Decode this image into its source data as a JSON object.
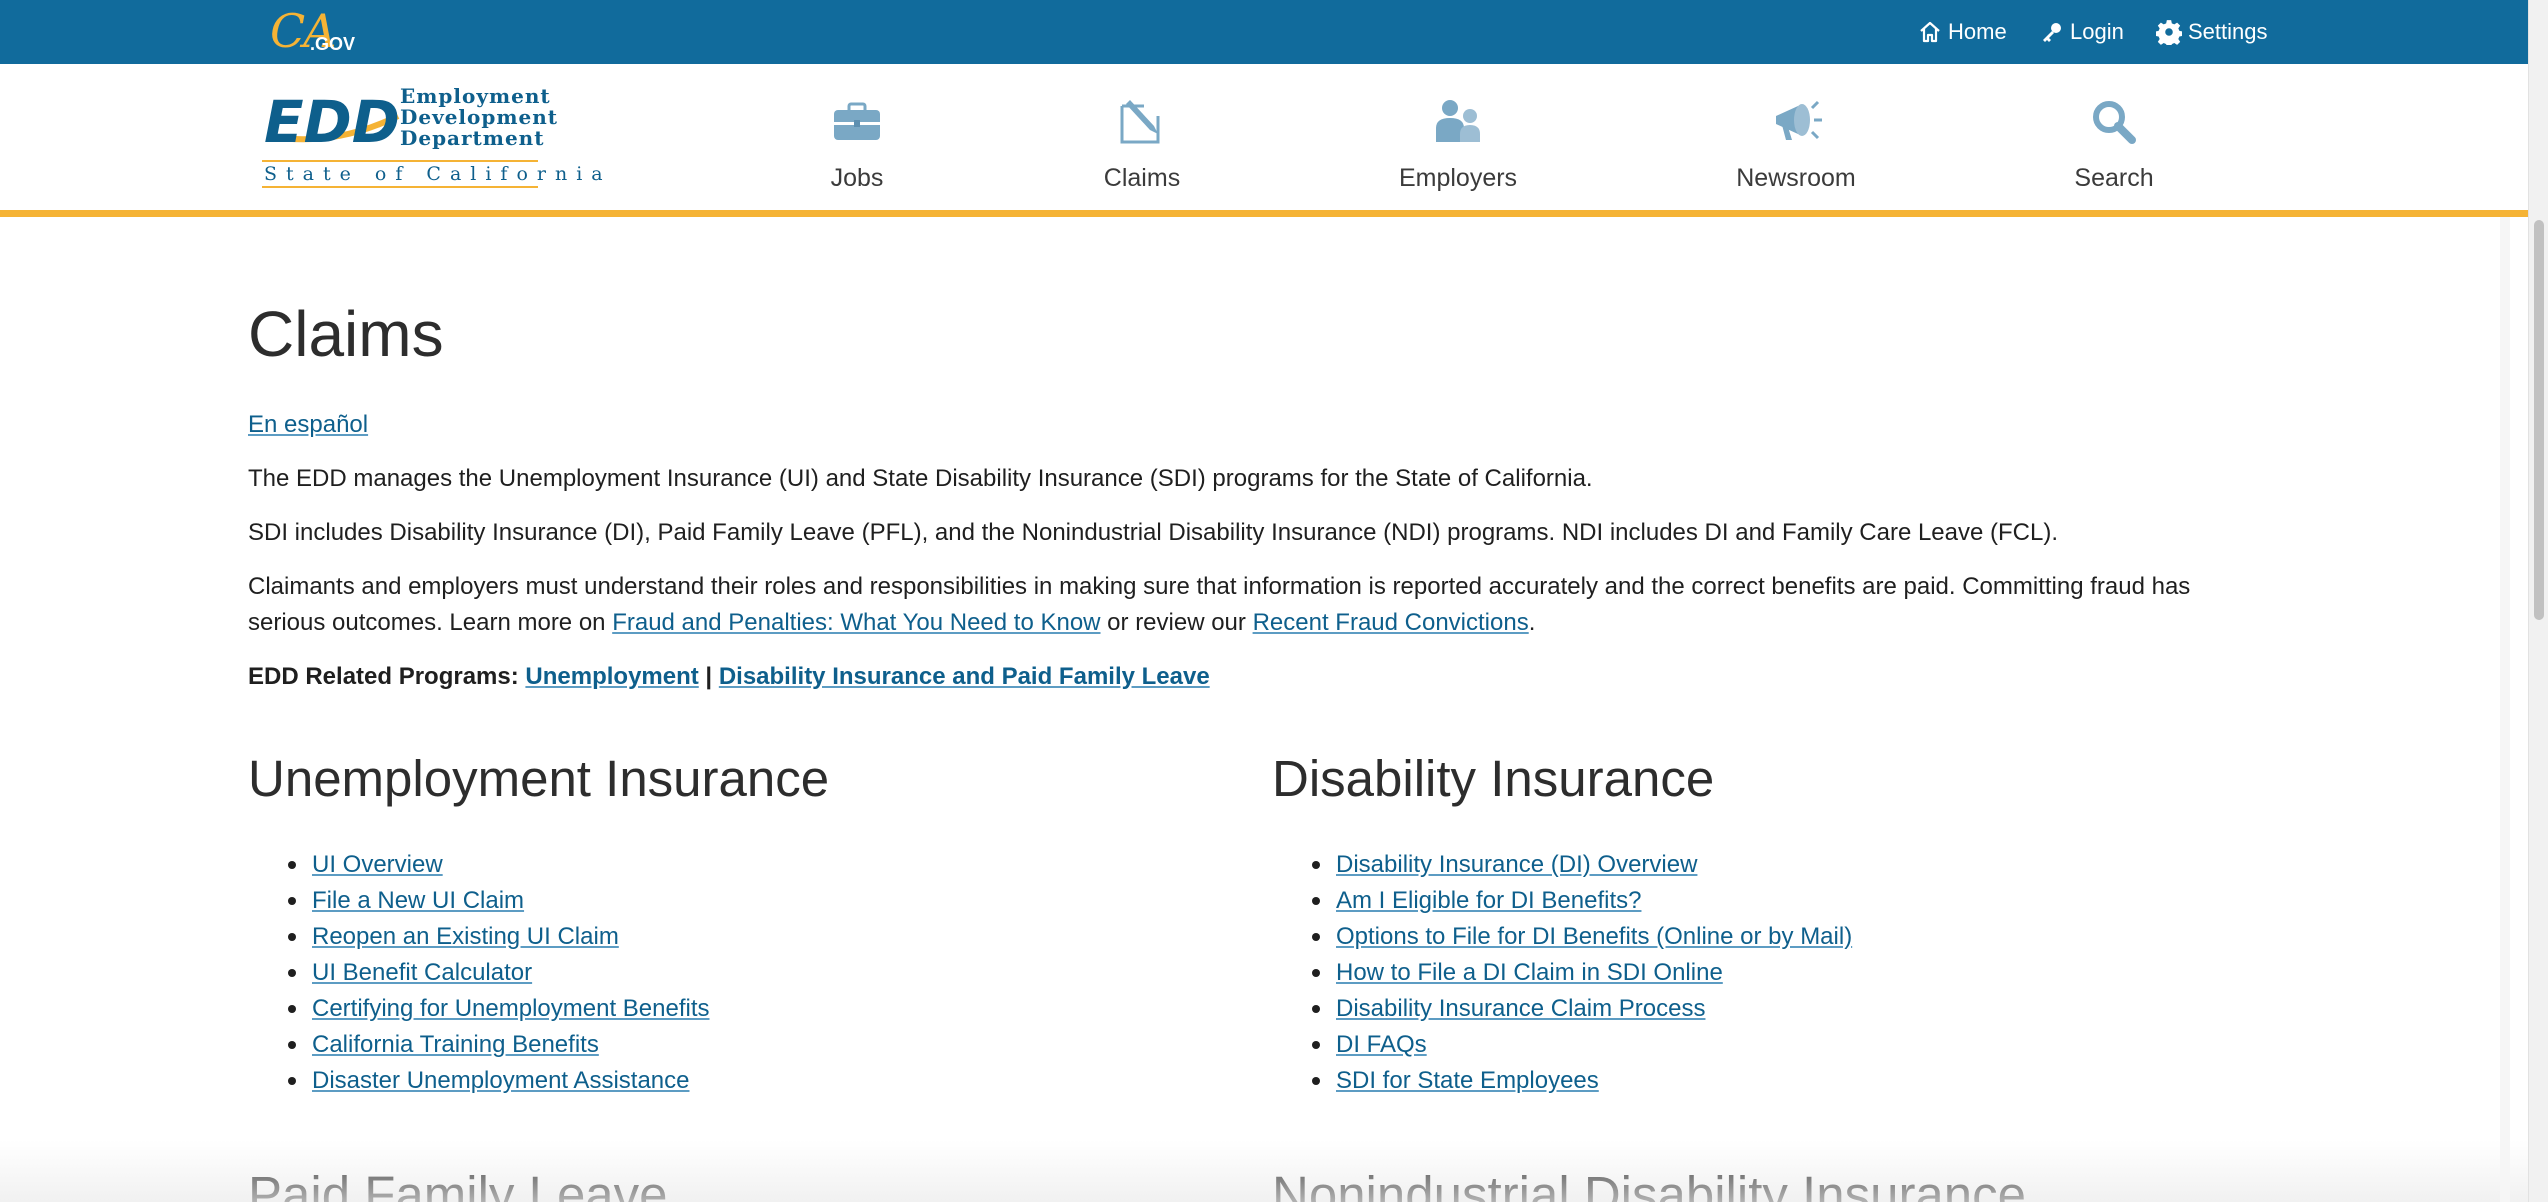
{
  "topbar": {
    "ca_logo_text": "CA",
    "ca_logo_gov": ".GOV",
    "home_label": "Home",
    "login_label": "Login",
    "settings_label": "Settings",
    "bg_color": "#116b9c"
  },
  "header": {
    "logo_line1": "Employment",
    "logo_line2": "Development",
    "logo_line3": "Department",
    "logo_state": "State of California",
    "logo_mark": "EDD",
    "nav": [
      {
        "label": "Jobs",
        "icon": "briefcase-icon"
      },
      {
        "label": "Claims",
        "icon": "claims-icon"
      },
      {
        "label": "Employers",
        "icon": "people-icon"
      },
      {
        "label": "Newsroom",
        "icon": "megaphone-icon"
      },
      {
        "label": "Search",
        "icon": "search-icon"
      }
    ],
    "accent_color": "#f5b335"
  },
  "main": {
    "title": "Claims",
    "espanol_link": "En español",
    "p1": "The EDD manages the Unemployment Insurance (UI) and State Disability Insurance (SDI) programs for the State of California.",
    "p2": "SDI includes Disability Insurance (DI), Paid Family Leave (PFL), and the Nonindustrial Disability Insurance (NDI) programs. NDI includes DI and Family Care Leave (FCL).",
    "p3_start": "Claimants and employers must understand their roles and responsibilities in making sure that information is reported accurately and the correct benefits are paid. Committing fraud has serious outcomes. Learn more on ",
    "p3_link1": "Fraud and Penalties: What You Need to Know",
    "p3_mid": " or review our ",
    "p3_link2": "Recent Fraud Convictions",
    "p3_end": ".",
    "related_label": "EDD Related Programs: ",
    "related_link1": "Unemployment",
    "related_sep": " | ",
    "related_link2": "Disability Insurance and Paid Family Leave",
    "sections": {
      "ui": {
        "title": "Unemployment Insurance",
        "links": [
          "UI Overview",
          "File a New UI Claim",
          "Reopen an Existing UI Claim",
          "UI Benefit Calculator",
          "Certifying for Unemployment Benefits",
          "California Training Benefits",
          "Disaster Unemployment Assistance"
        ]
      },
      "di": {
        "title": "Disability Insurance",
        "links": [
          "Disability Insurance (DI) Overview",
          "Am I Eligible for DI Benefits?",
          "Options to File for DI Benefits (Online or by Mail)",
          "How to File a DI Claim in SDI Online",
          "Disability Insurance Claim Process",
          "DI FAQs",
          "SDI for State Employees"
        ]
      },
      "pfl": {
        "title": "Paid Family Leave"
      },
      "ndi": {
        "title": "Nonindustrial Disability Insurance"
      }
    },
    "link_color": "#0e5f8c"
  }
}
